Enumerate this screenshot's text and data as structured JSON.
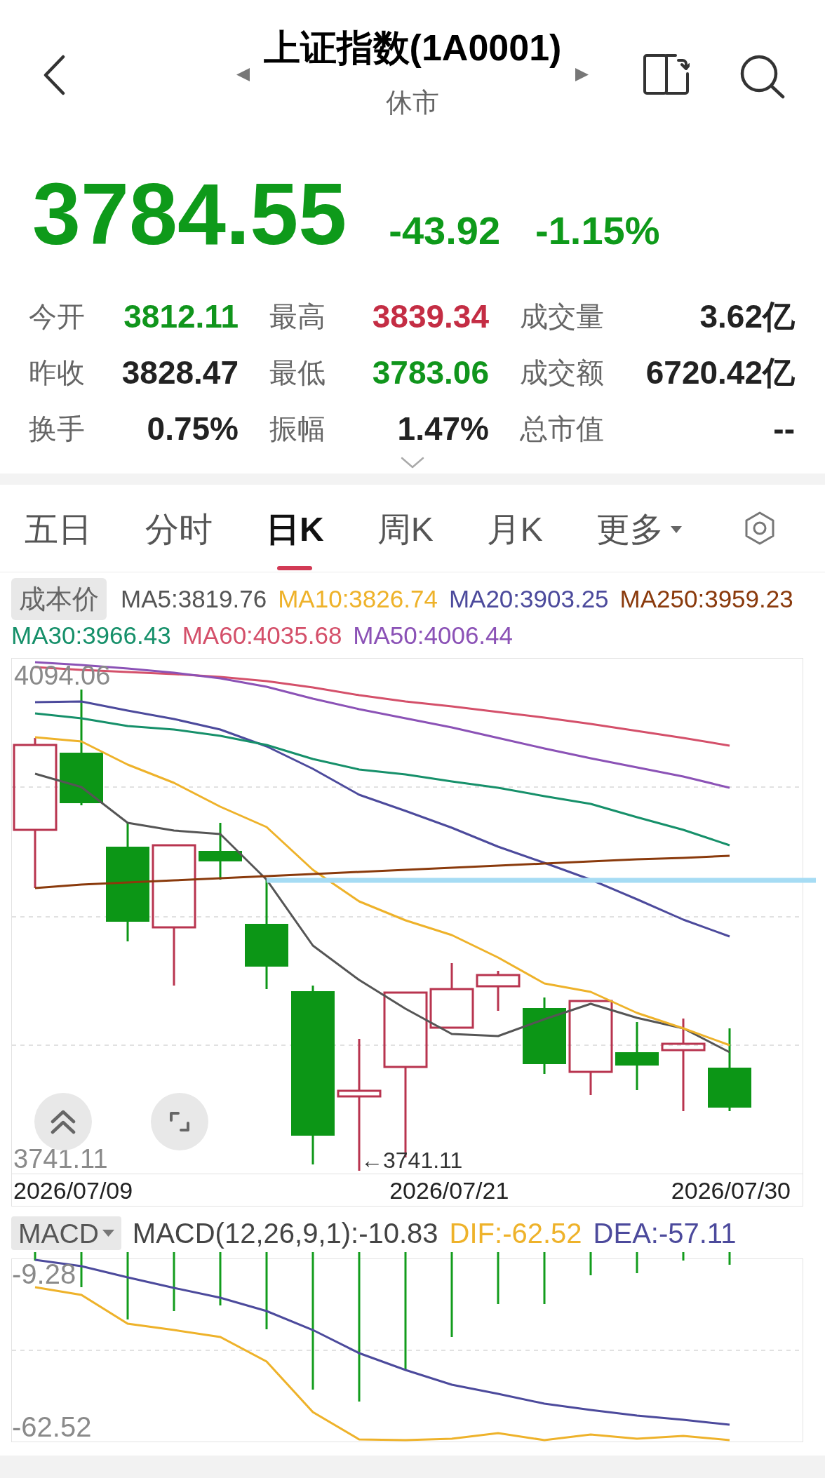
{
  "header": {
    "title": "上证指数(1A0001)",
    "status": "休市"
  },
  "quote": {
    "price": "3784.55",
    "change": "-43.92",
    "change_percent": "-1.15%",
    "falling": true
  },
  "stats": [
    {
      "label": "今开",
      "value": "3812.11",
      "color": "#10951c"
    },
    {
      "label": "最高",
      "value": "3839.34",
      "color": "#c42d44"
    },
    {
      "label": "成交量",
      "value": "3.62亿",
      "color": "#222222"
    },
    {
      "label": "昨收",
      "value": "3828.47",
      "color": "#222222"
    },
    {
      "label": "最低",
      "value": "3783.06",
      "color": "#10951c"
    },
    {
      "label": "成交额",
      "value": "6720.42亿",
      "color": "#222222"
    },
    {
      "label": "换手",
      "value": "0.75%",
      "color": "#222222"
    },
    {
      "label": "振幅",
      "value": "1.47%",
      "color": "#222222"
    },
    {
      "label": "总市值",
      "value": "--",
      "color": "#222222"
    }
  ],
  "period_tabs": [
    {
      "label": "五日",
      "selected": false,
      "kind": "tab"
    },
    {
      "label": "分时",
      "selected": false,
      "kind": "tab"
    },
    {
      "label": "日K",
      "selected": true,
      "kind": "tab"
    },
    {
      "label": "周K",
      "selected": false,
      "kind": "tab"
    },
    {
      "label": "月K",
      "selected": false,
      "kind": "tab"
    },
    {
      "label": "更多",
      "selected": false,
      "kind": "dropdown"
    }
  ],
  "ma_legend": {
    "button": "成本价",
    "items": [
      {
        "label": "MA5:3819.76",
        "color": "#555555"
      },
      {
        "label": "MA10:3826.74",
        "color": "#eeb22a"
      },
      {
        "label": "MA20:3903.25",
        "color": "#4c4a9c"
      },
      {
        "label": "MA250:3959.23",
        "color": "#8a3a0c"
      },
      {
        "label": "MA30:3966.43",
        "color": "#16906a"
      },
      {
        "label": "MA60:4035.68",
        "color": "#d4506a"
      },
      {
        "label": "MA50:4006.44",
        "color": "#8b52b6"
      }
    ]
  },
  "kline_chart": {
    "max_label": "4094.06",
    "min_label": "3741.11",
    "low_marker": "←3741.11",
    "dates": [
      "2026/07/09",
      "2026/07/21",
      "2026/07/30"
    ]
  },
  "macd": {
    "selector": "MACD",
    "items": [
      {
        "label": "MACD(12,26,9,1):-10.83",
        "color": "#444444"
      },
      {
        "label": "DIF:-62.52",
        "color": "#eeb22a"
      },
      {
        "label": "DEA:-57.11",
        "color": "#4c4a9c"
      }
    ],
    "max_label": "-9.28",
    "min_label": "-62.52"
  }
}
